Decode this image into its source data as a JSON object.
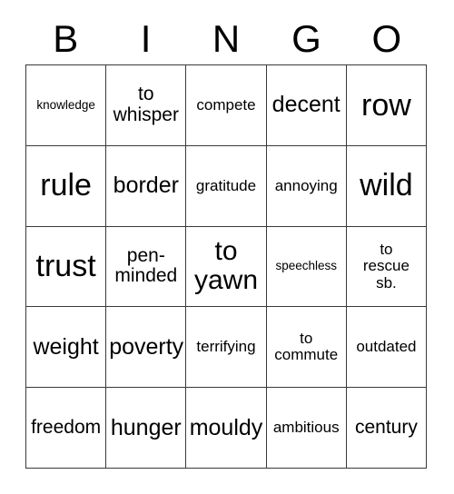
{
  "card": {
    "headers": [
      "B",
      "I",
      "N",
      "G",
      "O"
    ],
    "rows": [
      [
        {
          "text": "knowledge",
          "size": "fs-xs"
        },
        {
          "text": "to\nwhisper",
          "size": "fs-md"
        },
        {
          "text": "compete",
          "size": "fs-sm"
        },
        {
          "text": "decent",
          "size": "fs-lg"
        },
        {
          "text": "row",
          "size": "fs-xxl"
        }
      ],
      [
        {
          "text": "rule",
          "size": "fs-xxl"
        },
        {
          "text": "border",
          "size": "fs-lg"
        },
        {
          "text": "gratitude",
          "size": "fs-sm"
        },
        {
          "text": "annoying",
          "size": "fs-sm"
        },
        {
          "text": "wild",
          "size": "fs-xxl"
        }
      ],
      [
        {
          "text": "trust",
          "size": "fs-xxl"
        },
        {
          "text": "pen-\nminded",
          "size": "fs-md"
        },
        {
          "text": "to\nyawn",
          "size": "fs-xl"
        },
        {
          "text": "speechless",
          "size": "fs-xs"
        },
        {
          "text": "to\nrescue\nsb.",
          "size": "fs-sm"
        }
      ],
      [
        {
          "text": "weight",
          "size": "fs-lg"
        },
        {
          "text": "poverty",
          "size": "fs-lg"
        },
        {
          "text": "terrifying",
          "size": "fs-sm"
        },
        {
          "text": "to\ncommute",
          "size": "fs-sm"
        },
        {
          "text": "outdated",
          "size": "fs-sm"
        }
      ],
      [
        {
          "text": "freedom",
          "size": "fs-md"
        },
        {
          "text": "hunger",
          "size": "fs-lg"
        },
        {
          "text": "mouldy",
          "size": "fs-lg"
        },
        {
          "text": "ambitious",
          "size": "fs-sm"
        },
        {
          "text": "century",
          "size": "fs-md"
        }
      ]
    ]
  }
}
